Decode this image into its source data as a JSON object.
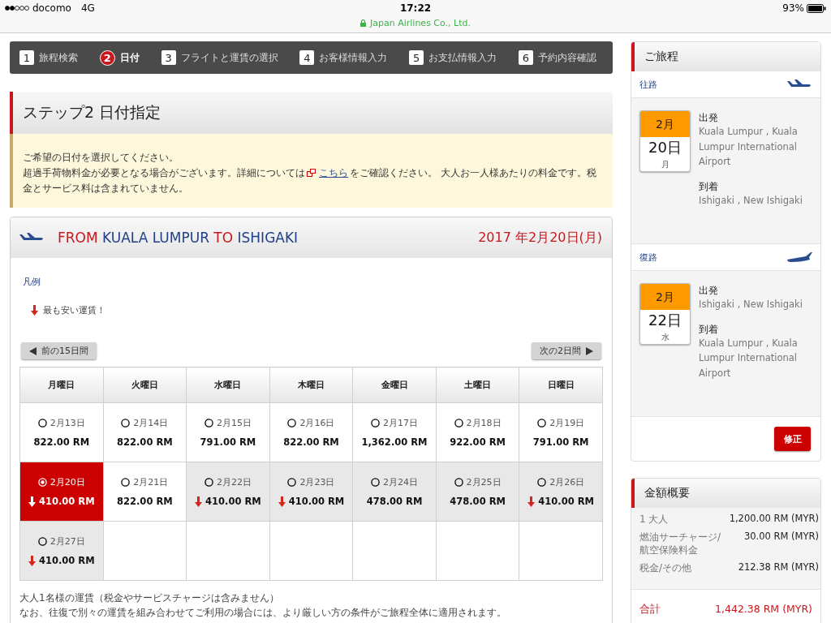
{
  "status_bar": {
    "carrier": "docomo",
    "network": "4G",
    "time": "17:22",
    "battery": "93%",
    "site": "Japan Airlines Co., Ltd."
  },
  "steps": [
    {
      "number": "1",
      "label": "旅程検索",
      "selected": false
    },
    {
      "number": "2",
      "label": "日付",
      "selected": true
    },
    {
      "number": "3",
      "label": "フライトと運賃の選択",
      "selected": false
    },
    {
      "number": "4",
      "label": "お客様情報入力",
      "selected": false
    },
    {
      "number": "5",
      "label": "お支払情報入力",
      "selected": false
    },
    {
      "number": "6",
      "label": "予約内容確認",
      "selected": false
    }
  ],
  "page_title": "ステップ2 日付指定",
  "notice": {
    "line_1": "ご希望の日付を選択してください。",
    "before_link": "超過手荷物料金が必要となる場合がございます。詳細については",
    "link": "こちら",
    "after_link": "をご確認ください。 大人お一人様あたりの料金です。税金とサービス料は含まれていません。"
  },
  "route": {
    "parts": [
      {
        "text": "FROM",
        "kind": "keyword"
      },
      {
        "text": "KUALA LUMPUR",
        "kind": "place"
      },
      {
        "text": "TO",
        "kind": "keyword"
      },
      {
        "text": "ISHIGAKI",
        "kind": "place"
      }
    ],
    "date": "2017 年2月20日(月)"
  },
  "legend": {
    "title": "凡例",
    "cheapest_label": "最も安い運賃！"
  },
  "prev_button": "前の15日間",
  "next_button": "次の2日間",
  "calendar": {
    "weekdays": [
      "月曜日",
      "火曜日",
      "水曜日",
      "木曜日",
      "金曜日",
      "土曜日",
      "日曜日"
    ],
    "rows": [
      [
        {
          "kind": "day",
          "date": "2月13日",
          "price": "822.00 RM",
          "cheapest": false,
          "selected": false,
          "shaded": false
        },
        {
          "kind": "day",
          "date": "2月14日",
          "price": "822.00 RM",
          "cheapest": false,
          "selected": false,
          "shaded": false
        },
        {
          "kind": "day",
          "date": "2月15日",
          "price": "791.00 RM",
          "cheapest": false,
          "selected": false,
          "shaded": false
        },
        {
          "kind": "day",
          "date": "2月16日",
          "price": "822.00 RM",
          "cheapest": false,
          "selected": false,
          "shaded": false
        },
        {
          "kind": "day",
          "date": "2月17日",
          "price": "1,362.00 RM",
          "cheapest": false,
          "selected": false,
          "shaded": false
        },
        {
          "kind": "day",
          "date": "2月18日",
          "price": "922.00 RM",
          "cheapest": false,
          "selected": false,
          "shaded": false
        },
        {
          "kind": "day",
          "date": "2月19日",
          "price": "791.00 RM",
          "cheapest": false,
          "selected": false,
          "shaded": false
        }
      ],
      [
        {
          "kind": "day",
          "date": "2月20日",
          "price": "410.00 RM",
          "cheapest": true,
          "selected": true,
          "shaded": false
        },
        {
          "kind": "day",
          "date": "2月21日",
          "price": "822.00 RM",
          "cheapest": false,
          "selected": false,
          "shaded": false
        },
        {
          "kind": "day",
          "date": "2月22日",
          "price": "410.00 RM",
          "cheapest": true,
          "selected": false,
          "shaded": true
        },
        {
          "kind": "day",
          "date": "2月23日",
          "price": "410.00 RM",
          "cheapest": true,
          "selected": false,
          "shaded": true
        },
        {
          "kind": "day",
          "date": "2月24日",
          "price": "478.00 RM",
          "cheapest": false,
          "selected": false,
          "shaded": true
        },
        {
          "kind": "day",
          "date": "2月25日",
          "price": "478.00 RM",
          "cheapest": false,
          "selected": false,
          "shaded": true
        },
        {
          "kind": "day",
          "date": "2月26日",
          "price": "410.00 RM",
          "cheapest": true,
          "selected": false,
          "shaded": true
        }
      ],
      [
        {
          "kind": "day",
          "date": "2月27日",
          "price": "410.00 RM",
          "cheapest": true,
          "selected": false,
          "shaded": true
        },
        {
          "kind": "empty"
        },
        {
          "kind": "empty"
        },
        {
          "kind": "empty"
        },
        {
          "kind": "empty"
        },
        {
          "kind": "empty"
        },
        {
          "kind": "empty"
        }
      ]
    ]
  },
  "notes": [
    "大人1名様の運賃（税金やサービスチャージは含みません）",
    "なお、往復で別々の運賃を組み合わせてご利用の場合には、より厳しい方の条件がご旅程全体に適用されます。"
  ],
  "itinerary": {
    "title": "ご旅程",
    "segments": [
      {
        "label": "往路",
        "kind": "outbound",
        "month": "2月",
        "day": "20日",
        "weekday": "月",
        "departure_label": "出発",
        "departure": "Kuala Lumpur , Kuala Lumpur International Airport",
        "arrival_label": "到着",
        "arrival": "Ishigaki , New Ishigaki"
      },
      {
        "label": "復路",
        "kind": "return",
        "month": "2月",
        "day": "22日",
        "weekday": "水",
        "departure_label": "出発",
        "departure": "Ishigaki , New Ishigaki",
        "arrival_label": "到着",
        "arrival": "Kuala Lumpur , Kuala Lumpur International Airport"
      }
    ],
    "edit_button": "修正"
  },
  "price_summary": {
    "title": "金額概要",
    "rows": [
      {
        "label": "1 大人",
        "value": "1,200.00 RM (MYR)"
      },
      {
        "label": "燃油サーチャージ/航空保険料金",
        "value": "30.00 RM (MYR)"
      },
      {
        "label": "税金/その他",
        "value": "212.38 RM (MYR)"
      }
    ],
    "total_label": "合計",
    "total": "1,442.38 RM (MYR)"
  }
}
